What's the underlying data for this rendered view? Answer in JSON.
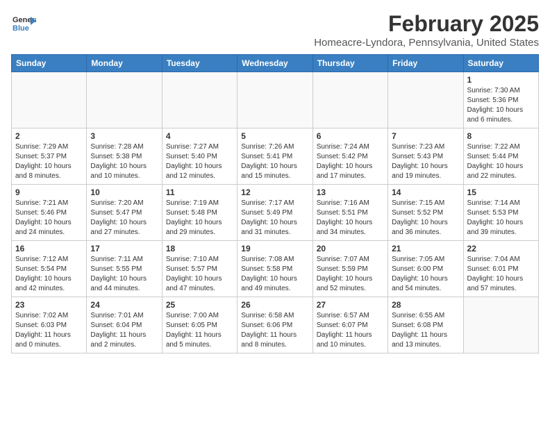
{
  "header": {
    "logo_line1": "General",
    "logo_line2": "Blue",
    "month_title": "February 2025",
    "location": "Homeacre-Lyndora, Pennsylvania, United States"
  },
  "weekdays": [
    "Sunday",
    "Monday",
    "Tuesday",
    "Wednesday",
    "Thursday",
    "Friday",
    "Saturday"
  ],
  "weeks": [
    [
      {
        "day": "",
        "info": ""
      },
      {
        "day": "",
        "info": ""
      },
      {
        "day": "",
        "info": ""
      },
      {
        "day": "",
        "info": ""
      },
      {
        "day": "",
        "info": ""
      },
      {
        "day": "",
        "info": ""
      },
      {
        "day": "1",
        "info": "Sunrise: 7:30 AM\nSunset: 5:36 PM\nDaylight: 10 hours and 6 minutes."
      }
    ],
    [
      {
        "day": "2",
        "info": "Sunrise: 7:29 AM\nSunset: 5:37 PM\nDaylight: 10 hours and 8 minutes."
      },
      {
        "day": "3",
        "info": "Sunrise: 7:28 AM\nSunset: 5:38 PM\nDaylight: 10 hours and 10 minutes."
      },
      {
        "day": "4",
        "info": "Sunrise: 7:27 AM\nSunset: 5:40 PM\nDaylight: 10 hours and 12 minutes."
      },
      {
        "day": "5",
        "info": "Sunrise: 7:26 AM\nSunset: 5:41 PM\nDaylight: 10 hours and 15 minutes."
      },
      {
        "day": "6",
        "info": "Sunrise: 7:24 AM\nSunset: 5:42 PM\nDaylight: 10 hours and 17 minutes."
      },
      {
        "day": "7",
        "info": "Sunrise: 7:23 AM\nSunset: 5:43 PM\nDaylight: 10 hours and 19 minutes."
      },
      {
        "day": "8",
        "info": "Sunrise: 7:22 AM\nSunset: 5:44 PM\nDaylight: 10 hours and 22 minutes."
      }
    ],
    [
      {
        "day": "9",
        "info": "Sunrise: 7:21 AM\nSunset: 5:46 PM\nDaylight: 10 hours and 24 minutes."
      },
      {
        "day": "10",
        "info": "Sunrise: 7:20 AM\nSunset: 5:47 PM\nDaylight: 10 hours and 27 minutes."
      },
      {
        "day": "11",
        "info": "Sunrise: 7:19 AM\nSunset: 5:48 PM\nDaylight: 10 hours and 29 minutes."
      },
      {
        "day": "12",
        "info": "Sunrise: 7:17 AM\nSunset: 5:49 PM\nDaylight: 10 hours and 31 minutes."
      },
      {
        "day": "13",
        "info": "Sunrise: 7:16 AM\nSunset: 5:51 PM\nDaylight: 10 hours and 34 minutes."
      },
      {
        "day": "14",
        "info": "Sunrise: 7:15 AM\nSunset: 5:52 PM\nDaylight: 10 hours and 36 minutes."
      },
      {
        "day": "15",
        "info": "Sunrise: 7:14 AM\nSunset: 5:53 PM\nDaylight: 10 hours and 39 minutes."
      }
    ],
    [
      {
        "day": "16",
        "info": "Sunrise: 7:12 AM\nSunset: 5:54 PM\nDaylight: 10 hours and 42 minutes."
      },
      {
        "day": "17",
        "info": "Sunrise: 7:11 AM\nSunset: 5:55 PM\nDaylight: 10 hours and 44 minutes."
      },
      {
        "day": "18",
        "info": "Sunrise: 7:10 AM\nSunset: 5:57 PM\nDaylight: 10 hours and 47 minutes."
      },
      {
        "day": "19",
        "info": "Sunrise: 7:08 AM\nSunset: 5:58 PM\nDaylight: 10 hours and 49 minutes."
      },
      {
        "day": "20",
        "info": "Sunrise: 7:07 AM\nSunset: 5:59 PM\nDaylight: 10 hours and 52 minutes."
      },
      {
        "day": "21",
        "info": "Sunrise: 7:05 AM\nSunset: 6:00 PM\nDaylight: 10 hours and 54 minutes."
      },
      {
        "day": "22",
        "info": "Sunrise: 7:04 AM\nSunset: 6:01 PM\nDaylight: 10 hours and 57 minutes."
      }
    ],
    [
      {
        "day": "23",
        "info": "Sunrise: 7:02 AM\nSunset: 6:03 PM\nDaylight: 11 hours and 0 minutes."
      },
      {
        "day": "24",
        "info": "Sunrise: 7:01 AM\nSunset: 6:04 PM\nDaylight: 11 hours and 2 minutes."
      },
      {
        "day": "25",
        "info": "Sunrise: 7:00 AM\nSunset: 6:05 PM\nDaylight: 11 hours and 5 minutes."
      },
      {
        "day": "26",
        "info": "Sunrise: 6:58 AM\nSunset: 6:06 PM\nDaylight: 11 hours and 8 minutes."
      },
      {
        "day": "27",
        "info": "Sunrise: 6:57 AM\nSunset: 6:07 PM\nDaylight: 11 hours and 10 minutes."
      },
      {
        "day": "28",
        "info": "Sunrise: 6:55 AM\nSunset: 6:08 PM\nDaylight: 11 hours and 13 minutes."
      },
      {
        "day": "",
        "info": ""
      }
    ]
  ]
}
